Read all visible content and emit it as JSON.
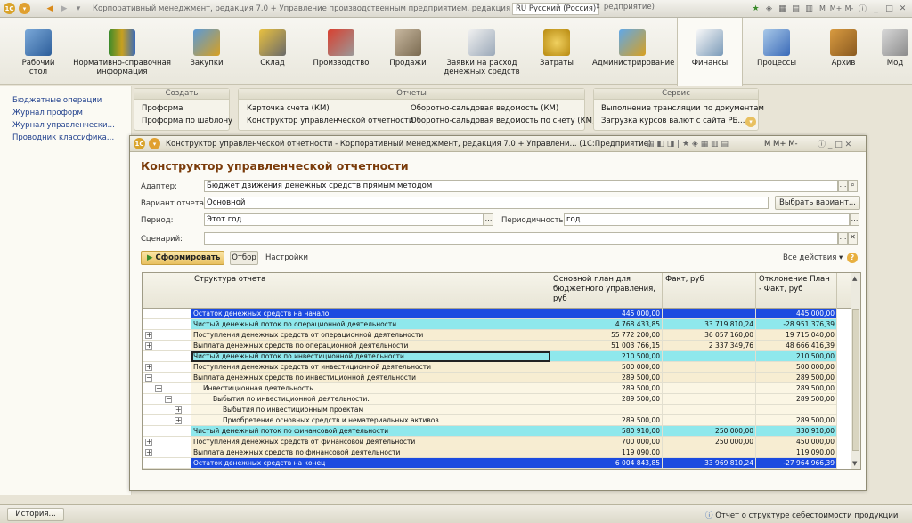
{
  "app": {
    "title": "Корпоративный менеджмент, редакция 7.0 + Управление производственным предприятием, редакция 1.3",
    "lang": "RU Русский (Россия)",
    "suffix": "редприятие)"
  },
  "sections": [
    {
      "label": "Рабочий\nстол",
      "icon": "desk-icon"
    },
    {
      "label": "Нормативно-справочная\nинформация",
      "icon": "books-icon"
    },
    {
      "label": "Закупки",
      "icon": "truck-icon"
    },
    {
      "label": "Склад",
      "icon": "forklift-icon"
    },
    {
      "label": "Производство",
      "icon": "factory-icon"
    },
    {
      "label": "Продажи",
      "icon": "car-icon"
    },
    {
      "label": "Заявки на расход\nденежных средств",
      "icon": "clipboard-icon"
    },
    {
      "label": "Затраты",
      "icon": "coins-icon"
    },
    {
      "label": "Администрирование",
      "icon": "admin-icon"
    },
    {
      "label": "Финансы",
      "icon": "finance-icon"
    },
    {
      "label": "Процессы",
      "icon": "process-icon"
    },
    {
      "label": "Архив",
      "icon": "archive-icon"
    },
    {
      "label": "Мод",
      "icon": "module-icon"
    }
  ],
  "nav": [
    "Бюджетные операции",
    "Журнал проформ",
    "Журнал управленческих п...",
    "Проводник классификато..."
  ],
  "groups": {
    "create": {
      "title": "Создать",
      "items": [
        "Проформа",
        "Проформа по шаблону"
      ]
    },
    "reports": {
      "title": "Отчеты",
      "items": [
        "Карточка счета (КМ)",
        "Конструктор управленческой отчетности",
        "Оборотно-сальдовая ведомость (КМ)",
        "Оборотно-сальдовая ведомость по счету (КМ)"
      ]
    },
    "service": {
      "title": "Сервис",
      "items": [
        "Выполнение трансляции по документам",
        "Загрузка курсов валют с сайта РБ..."
      ]
    }
  },
  "modal": {
    "title": "Конструктор управленческой отчетности - Корпоративный менеджмент, редакция 7.0 + Управлени... (1С:Предприятие)",
    "heading": "Конструктор управленческой отчетности",
    "labels": {
      "adapter": "Адаптер:",
      "variant": "Вариант отчета:",
      "period": "Период:",
      "periodicity": "Периодичность:",
      "scenario": "Сценарий:"
    },
    "values": {
      "adapter": "Бюджет движения денежных средств прямым методом",
      "variant": "Основной",
      "period": "Этот год",
      "periodicity": "год",
      "scenario": ""
    },
    "buttons": {
      "choose_variant": "Выбрать вариант...",
      "generate": "Сформировать",
      "filter": "Отбор",
      "settings": "Настройки",
      "all_actions": "Все действия"
    },
    "tb_letters": "M  M+  M-"
  },
  "table": {
    "headers": [
      "Структура отчета",
      "Основной план для бюджетного управления, руб",
      "Факт, руб",
      "Отклонение План - Факт, руб"
    ],
    "rows": [
      {
        "name": "Остаток денежных средств на начало",
        "plan": "445 000,00",
        "fact": "",
        "dev": "445 000,00",
        "style": "blue",
        "indent": 0,
        "exp": []
      },
      {
        "name": "Чистый денежный поток по операционной деятельности",
        "plan": "4 768 433,85",
        "fact": "33 719 810,24",
        "dev": "-28 951 376,39",
        "style": "cyan",
        "indent": 0,
        "exp": []
      },
      {
        "name": "Поступления денежных средств от операционной деятельности",
        "plan": "55 772 200,00",
        "fact": "36 057 160,00",
        "dev": "19 715 040,00",
        "style": "beige",
        "indent": 0,
        "exp": [
          "+"
        ]
      },
      {
        "name": "Выплата денежных средств по операционной деятельности",
        "plan": "51 003 766,15",
        "fact": "2 337 349,76",
        "dev": "48 666 416,39",
        "style": "beige",
        "indent": 0,
        "exp": [
          "+"
        ]
      },
      {
        "name": "Чистый денежный поток по инвестиционной деятельности",
        "plan": "210 500,00",
        "fact": "",
        "dev": "210 500,00",
        "style": "cyansel",
        "indent": 0,
        "exp": []
      },
      {
        "name": "Поступления денежных средств от инвестиционной деятельности",
        "plan": "500 000,00",
        "fact": "",
        "dev": "500 000,00",
        "style": "beige",
        "indent": 0,
        "exp": [
          "+"
        ]
      },
      {
        "name": "Выплата денежных средств по инвестиционной деятельности",
        "plan": "289 500,00",
        "fact": "",
        "dev": "289 500,00",
        "style": "beige",
        "indent": 0,
        "exp": [
          "-"
        ]
      },
      {
        "name": "Инвестиционная деятельность",
        "plan": "289 500,00",
        "fact": "",
        "dev": "289 500,00",
        "style": "light",
        "indent": 1,
        "exp": [
          "",
          "-"
        ]
      },
      {
        "name": "Выбытия по инвестиционной деятельности:",
        "plan": "289 500,00",
        "fact": "",
        "dev": "289 500,00",
        "style": "light",
        "indent": 2,
        "exp": [
          "",
          "",
          "-"
        ]
      },
      {
        "name": "Выбытия по инвестиционным проектам",
        "plan": "",
        "fact": "",
        "dev": "",
        "style": "light",
        "indent": 3,
        "exp": [
          "",
          "",
          "",
          "+"
        ]
      },
      {
        "name": "Приобретение основных средств и нематериальных активов",
        "plan": "289 500,00",
        "fact": "",
        "dev": "289 500,00",
        "style": "light",
        "indent": 3,
        "exp": [
          "",
          "",
          "",
          "+"
        ]
      },
      {
        "name": "Чистый денежный поток по финансовой деятельности",
        "plan": "580 910,00",
        "fact": "250 000,00",
        "dev": "330 910,00",
        "style": "cyan",
        "indent": 0,
        "exp": []
      },
      {
        "name": "Поступления денежных средств от финансовой деятельности",
        "plan": "700 000,00",
        "fact": "250 000,00",
        "dev": "450 000,00",
        "style": "beige",
        "indent": 0,
        "exp": [
          "+"
        ]
      },
      {
        "name": "Выплата денежных средств по финансовой деятельности",
        "plan": "119 090,00",
        "fact": "",
        "dev": "119 090,00",
        "style": "beige",
        "indent": 0,
        "exp": [
          "+"
        ]
      },
      {
        "name": "Остаток денежных средств на конец",
        "plan": "6 004 843,85",
        "fact": "33 969 810,24",
        "dev": "-27 964 966,39",
        "style": "blue",
        "indent": 0,
        "exp": []
      }
    ]
  },
  "status": {
    "history": "История...",
    "message": "Отчет о структуре себестоимости продукции"
  },
  "colors": {
    "blue": "#1c4be0",
    "cyan": "#8fe8ec",
    "beige": "#f7edd2",
    "light": "#fbf6e4",
    "heading": "#7a3b0a"
  }
}
